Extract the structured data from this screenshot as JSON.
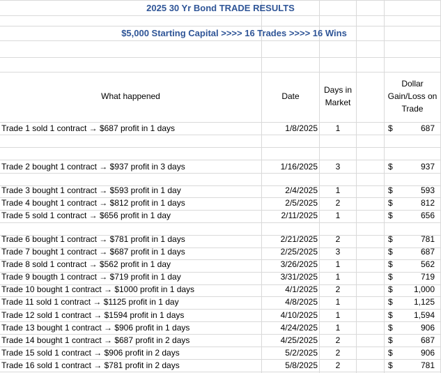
{
  "title": "2025 30 Yr Bond TRADE RESULTS",
  "subtitle": "$5,000 Starting Capital >>>>  16 Trades >>>>  16 Wins",
  "headers": {
    "what": "What happened",
    "date": "Date",
    "days_l1": "Days in",
    "days_l2": "Market",
    "gain_l1": "Dollar",
    "gain_l2": "Gain/Loss on",
    "gain_l3": "Trade"
  },
  "currency_symbol": "$",
  "trades": [
    {
      "text": "Trade 1 sold 1 contract → $687 profit  in 1 days",
      "date": "1/8/2025",
      "days": "1",
      "amount": "687"
    },
    {
      "text": "Trade 2 bought 1 contract → $937 profit in 3 days",
      "date": "1/16/2025",
      "days": "3",
      "amount": "937"
    },
    {
      "text": "Trade 3 bought 1 contract → $593 profit in 1 day",
      "date": "2/4/2025",
      "days": "1",
      "amount": "593"
    },
    {
      "text": "Trade 4 bought 1 contract → $812 profit in 1 days",
      "date": "2/5/2025",
      "days": "2",
      "amount": "812"
    },
    {
      "text": "Trade 5 sold 1 contract → $656 profit in 1 day",
      "date": "2/11/2025",
      "days": "1",
      "amount": "656"
    },
    {
      "text": "Trade 6 bought 1 contract → $781 profit in 1 days",
      "date": "2/21/2025",
      "days": "2",
      "amount": "781"
    },
    {
      "text": "Trade 7 bought 1 contract → $687 profit in 1 days",
      "date": "2/25/2025",
      "days": "3",
      "amount": "687"
    },
    {
      "text": "Trade 8 sold 1 contract → $562 profit in 1 day",
      "date": "3/26/2025",
      "days": "1",
      "amount": "562"
    },
    {
      "text": "Trade 9 bougth 1 contract → $719 profit in 1 day",
      "date": "3/31/2025",
      "days": "1",
      "amount": "719"
    },
    {
      "text": "Trade 10 bought 1 contract → $1000 profit in 1 days",
      "date": "4/1/2025",
      "days": "2",
      "amount": "1,000"
    },
    {
      "text": "Trade 11 sold 1 contract → $1125 profit in 1 day",
      "date": "4/8/2025",
      "days": "1",
      "amount": "1,125"
    },
    {
      "text": "Trade 12 sold 1 contract → $1594 profit in 1 days",
      "date": "4/10/2025",
      "days": "1",
      "amount": "1,594"
    },
    {
      "text": "Trade 13 bought 1 contract → $906 profit in 1 days",
      "date": "4/24/2025",
      "days": "1",
      "amount": "906"
    },
    {
      "text": "Trade 14 bought 1 contract → $687 profit in 2 days",
      "date": "4/25/2025",
      "days": "2",
      "amount": "687"
    },
    {
      "text": "Trade 15  sold 1 contract → $906 profit in 2 days",
      "date": "5/2/2025",
      "days": "2",
      "amount": "906"
    },
    {
      "text": "Trade 16  sold 1 contract → $781 profit in 2 days",
      "date": "5/8/2025",
      "days": "2",
      "amount": "781"
    }
  ]
}
